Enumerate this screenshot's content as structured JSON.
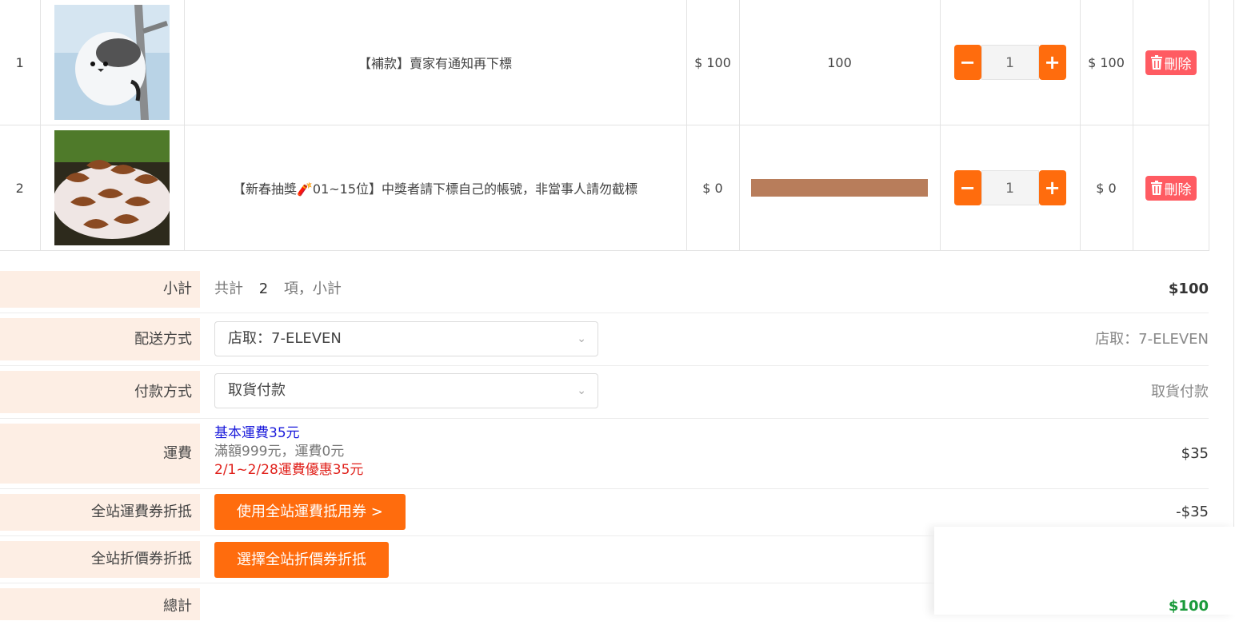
{
  "cart": {
    "items": [
      {
        "index": "1",
        "name": "【補款】賣家有通知再下標",
        "price": "$ 100",
        "field": "100",
        "qty": "1",
        "subtotal": "$ 100",
        "delete_label": "刪除"
      },
      {
        "index": "2",
        "name": "【新春抽獎🧨01~15位】中獎者請下標自己的帳號，非當事人請勿截標",
        "price": "$ 0",
        "field": "",
        "qty": "1",
        "subtotal": "$ 0",
        "delete_label": "刪除"
      }
    ],
    "minus_symbol": "−",
    "plus_symbol": "+"
  },
  "summary": {
    "subtotal": {
      "label": "小計",
      "text_prefix": "共計",
      "count": "2",
      "text_suffix": "項，小計",
      "value": "$100"
    },
    "shipping_method": {
      "label": "配送方式",
      "selected": "店取：7-ELEVEN",
      "value": "店取：7-ELEVEN"
    },
    "payment_method": {
      "label": "付款方式",
      "selected": "取貨付款",
      "value": "取貨付款"
    },
    "shipping_fee": {
      "label": "運費",
      "line1": "基本運費35元",
      "line2": "滿額999元，運費0元",
      "line3": "2/1~2/28運費優惠35元",
      "value": "$35"
    },
    "shipping_coupon": {
      "label": "全站運費券折抵",
      "button": "使用全站運費抵用券 >",
      "value": "-$35"
    },
    "discount_coupon": {
      "label": "全站折價券折抵",
      "button": "選擇全站折價券折抵"
    },
    "total": {
      "label": "總計",
      "value": "$100"
    }
  },
  "colors": {
    "accent": "#ff6c0d",
    "delete": "#ff5b62",
    "label_bg": "#fdeee4",
    "blue": "#1a1adb",
    "red": "#e0201a",
    "green": "#1a9a3a"
  }
}
